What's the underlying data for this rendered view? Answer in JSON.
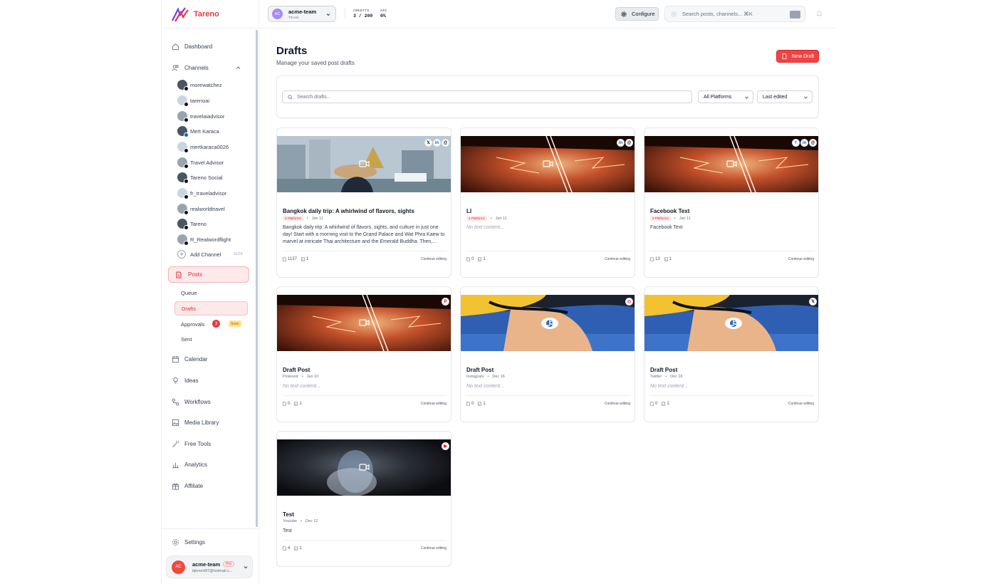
{
  "brand": {
    "name": "Tareno"
  },
  "topbar": {
    "team_name": "acme-team",
    "team_sub": "TEAM",
    "team_avatar": "AC",
    "credits_label": "CREDITS",
    "credits_value": "3 / 200",
    "api_label": "API",
    "api_value": "0%",
    "configure_label": "Configure",
    "search_placeholder": "Search posts, channels... ⌘K"
  },
  "sidebar": {
    "dashboard": "Dashboard",
    "channels": "Channels",
    "channel_list": [
      "morewatchez",
      "tarenoai",
      "travelaiadvisor",
      "Mert Karaca",
      "mertkaraca0026",
      "Travel Advisor",
      "Tareno Social",
      "fr_traveladvisor",
      "realworldtravel",
      "Tareno",
      "R_Realwordflight"
    ],
    "add_channel": "Add Channel",
    "channel_count": "11/15",
    "posts": "Posts",
    "queue": "Queue",
    "drafts": "Drafts",
    "approvals": "Approvals",
    "approvals_count": "3",
    "soon": "Soon",
    "sent": "Sent",
    "calendar": "Calendar",
    "ideas": "Ideas",
    "workflows": "Workflows",
    "media_library": "Media Library",
    "free_tools": "Free Tools",
    "analytics": "Analytics",
    "affiliate": "Affiliate",
    "settings": "Settings",
    "account": {
      "avatar": "AC",
      "name": "acme-team",
      "badge": "Pro",
      "email": "bjkmert97@hotmail.c..."
    }
  },
  "main": {
    "title": "Drafts",
    "subtitle": "Manage your saved post drafts",
    "new_draft": "New Draft",
    "search_placeholder": "Search drafts...",
    "platform_filter": "All Platforms",
    "sort": "Last edited",
    "continue_label": "Continue editing",
    "cards": [
      {
        "title": "Bangkok daily trip: A whirlwind of flavors, sights",
        "platform": "3 Platforms",
        "date": "Jan 11",
        "body": "Bangkok daily trip: A whirlwind of flavors, sights, and culture in just one day! Start with a morning visit to the Grand Palace and Wat Phra Kaew to marvel at intricate Thai architecture and the Emerald Buddha. Then,...",
        "chars": "1137",
        "media": "1",
        "icons": [
          "x-icon",
          "linkedin-icon",
          "threads-icon"
        ]
      },
      {
        "title": "LI",
        "platform": "2 Platforms",
        "date": "Jan 11",
        "body": "No text content...",
        "chars": "0",
        "media": "1",
        "icons": [
          "linkedin-icon",
          "threads-icon"
        ]
      },
      {
        "title": "Facebook Text",
        "platform": "3 Platforms",
        "date": "Jan 11",
        "body": "Facebook Text",
        "chars": "13",
        "media": "1",
        "icons": [
          "facebook-icon",
          "linkedin-icon",
          "threads-icon"
        ]
      },
      {
        "title": "Draft Post",
        "platform": "Pinterest",
        "date": "Jan 10",
        "body": "No text content...",
        "chars": "0",
        "media": "1",
        "icons": [
          "pinterest-icon"
        ]
      },
      {
        "title": "Draft Post",
        "platform": "Instagram",
        "date": "Dec 16",
        "body": "No text content...",
        "chars": "0",
        "media": "1",
        "icons": [
          "instagram-icon"
        ]
      },
      {
        "title": "Draft Post",
        "platform": "Twitter",
        "date": "Dec 16",
        "body": "No text content...",
        "chars": "0",
        "media": "1",
        "icons": [
          "x-icon"
        ]
      },
      {
        "title": "Test",
        "platform": "Youtube",
        "date": "Dec 12",
        "body": "Test",
        "chars": "4",
        "media": "1",
        "icons": [
          "youtube-icon"
        ]
      }
    ]
  },
  "colors": {
    "accent": "#e23b41",
    "accent_light": "#fde8ea"
  }
}
